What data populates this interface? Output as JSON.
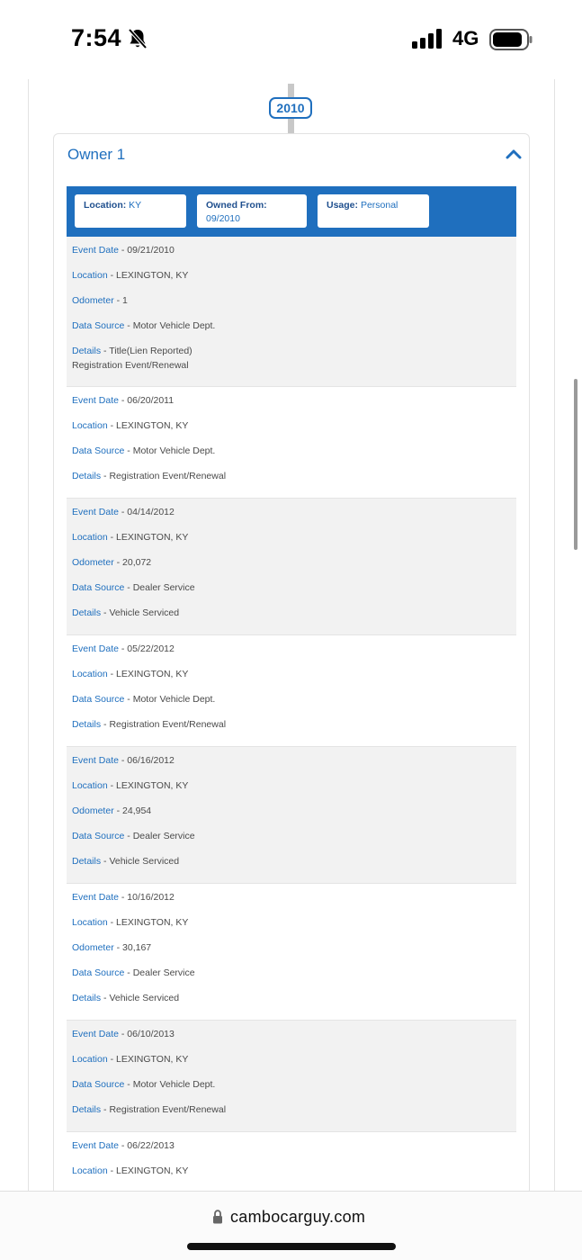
{
  "status_bar": {
    "time": "7:54",
    "network": "4G",
    "icons": [
      "bell-slash-icon",
      "signal-icon",
      "battery-icon"
    ]
  },
  "timeline": {
    "year": "2010"
  },
  "owner": {
    "title": "Owner 1",
    "location_label": "Location:",
    "location_value": "KY",
    "owned_from_label": "Owned From:",
    "owned_from_value": "09/2010",
    "usage_label": "Usage:",
    "usage_value": "Personal"
  },
  "events": [
    {
      "shaded": true,
      "rows": [
        {
          "key": "Event Date",
          "value": "09/21/2010"
        },
        {
          "key": "Location",
          "value": "LEXINGTON, KY"
        },
        {
          "key": "Odometer",
          "value": "1"
        },
        {
          "key": "Data Source",
          "value": "Motor Vehicle Dept."
        },
        {
          "key": "Details",
          "value": "Title(Lien Reported)",
          "value2": "Registration Event/Renewal"
        }
      ]
    },
    {
      "shaded": false,
      "rows": [
        {
          "key": "Event Date",
          "value": "06/20/2011"
        },
        {
          "key": "Location",
          "value": "LEXINGTON, KY"
        },
        {
          "key": "Data Source",
          "value": "Motor Vehicle Dept."
        },
        {
          "key": "Details",
          "value": "Registration Event/Renewal"
        }
      ]
    },
    {
      "shaded": true,
      "rows": [
        {
          "key": "Event Date",
          "value": "04/14/2012"
        },
        {
          "key": "Location",
          "value": "LEXINGTON, KY"
        },
        {
          "key": "Odometer",
          "value": "20,072"
        },
        {
          "key": "Data Source",
          "value": "Dealer Service"
        },
        {
          "key": "Details",
          "value": "Vehicle Serviced"
        }
      ]
    },
    {
      "shaded": false,
      "rows": [
        {
          "key": "Event Date",
          "value": "05/22/2012"
        },
        {
          "key": "Location",
          "value": "LEXINGTON, KY"
        },
        {
          "key": "Data Source",
          "value": "Motor Vehicle Dept."
        },
        {
          "key": "Details",
          "value": "Registration Event/Renewal"
        }
      ]
    },
    {
      "shaded": true,
      "rows": [
        {
          "key": "Event Date",
          "value": "06/16/2012"
        },
        {
          "key": "Location",
          "value": "LEXINGTON, KY"
        },
        {
          "key": "Odometer",
          "value": "24,954"
        },
        {
          "key": "Data Source",
          "value": "Dealer Service"
        },
        {
          "key": "Details",
          "value": "Vehicle Serviced"
        }
      ]
    },
    {
      "shaded": false,
      "rows": [
        {
          "key": "Event Date",
          "value": "10/16/2012"
        },
        {
          "key": "Location",
          "value": "LEXINGTON, KY"
        },
        {
          "key": "Odometer",
          "value": "30,167"
        },
        {
          "key": "Data Source",
          "value": "Dealer Service"
        },
        {
          "key": "Details",
          "value": "Vehicle Serviced"
        }
      ]
    },
    {
      "shaded": true,
      "rows": [
        {
          "key": "Event Date",
          "value": "06/10/2013"
        },
        {
          "key": "Location",
          "value": "LEXINGTON, KY"
        },
        {
          "key": "Data Source",
          "value": "Motor Vehicle Dept."
        },
        {
          "key": "Details",
          "value": "Registration Event/Renewal"
        }
      ]
    },
    {
      "shaded": false,
      "rows": [
        {
          "key": "Event Date",
          "value": "06/22/2013"
        },
        {
          "key": "Location",
          "value": "LEXINGTON, KY"
        }
      ]
    }
  ],
  "browser": {
    "url": "cambocarguy.com",
    "icons": [
      "lock-icon"
    ]
  },
  "colors": {
    "accent": "#1f6fbe",
    "shaded_row": "#f2f2f2",
    "text": "#4a4a4a"
  }
}
